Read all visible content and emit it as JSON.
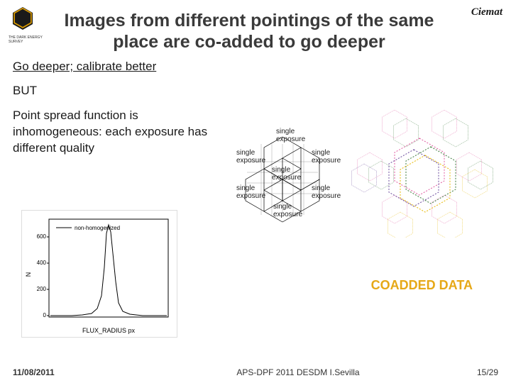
{
  "header": {
    "title": "Images from different pointings of the same place are co-added to go deeper",
    "logo_right_text": "Ciemat",
    "logo_left_sub": "THE DARK ENERGY SURVEY"
  },
  "content": {
    "line1": "Go deeper; calibrate better",
    "line2": "BUT",
    "line3": "Point spread function is inhomogeneous: each exposure has different quality",
    "hex_labels": {
      "top": "single\nexposure",
      "ml": "single\nexposure",
      "mr": "single\nexposure",
      "mid": "single\nexposure",
      "bl": "single\nexposure",
      "br": "single\nexposure",
      "bot": "single\nexposure"
    },
    "plot": {
      "legend": "non-homogenized",
      "xlabel": "FLUX_RADIUS px",
      "ylabel": "N",
      "y_ticks": [
        "0",
        "200",
        "400",
        "600"
      ]
    },
    "coadded_caption": "COADDED DATA"
  },
  "footer": {
    "date": "11/08/2011",
    "center": "APS-DPF 2011 DESDM I.Sevilla",
    "page": "15/29"
  }
}
